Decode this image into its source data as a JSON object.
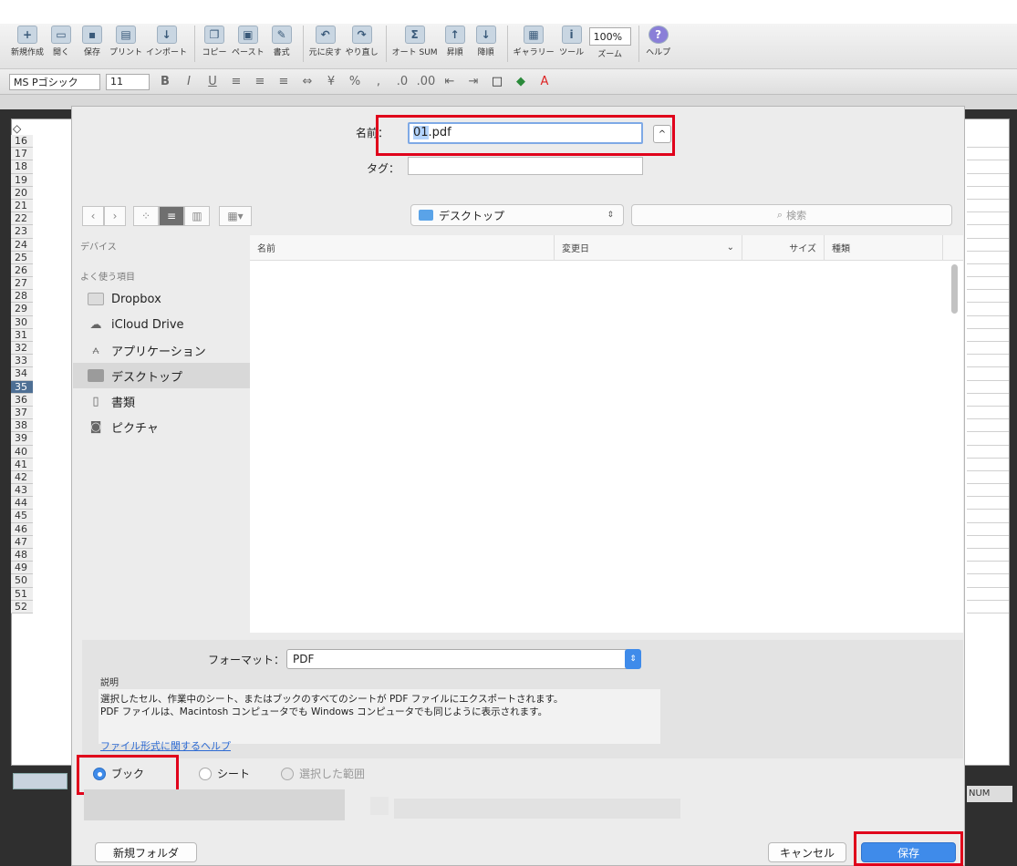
{
  "ribbon": {
    "buttons": [
      "新規作成",
      "開く",
      "保存",
      "プリント",
      "インポート",
      "コピー",
      "ペースト",
      "書式",
      "元に戻す",
      "やり直し",
      "オート SUM",
      "昇順",
      "降順",
      "ギャラリー",
      "ツール",
      "ズーム",
      "ヘルプ"
    ],
    "zoom": "100%"
  },
  "formatbar": {
    "font": "MS Pゴシック",
    "size": "11"
  },
  "sheet": {
    "rows": [
      "16",
      "17",
      "18",
      "19",
      "20",
      "21",
      "22",
      "23",
      "24",
      "25",
      "26",
      "27",
      "28",
      "29",
      "30",
      "31",
      "32",
      "33",
      "34",
      "35",
      "36",
      "37",
      "38",
      "39",
      "40",
      "41",
      "42",
      "43",
      "44",
      "45",
      "46",
      "47",
      "48",
      "49",
      "50",
      "51",
      "52"
    ],
    "selected_row": "35",
    "status": "NUM"
  },
  "dialog": {
    "name_label": "名前：",
    "filename_highlight": "01",
    "filename_rest": ".pdf",
    "tag_label": "タグ：",
    "location": "デスクトップ",
    "search_placeholder": "検索",
    "sidebar": {
      "devices": "デバイス",
      "favorites": "よく使う項目",
      "items": [
        "Dropbox",
        "iCloud Drive",
        "アプリケーション",
        "デスクトップ",
        "書類",
        "ピクチャ"
      ]
    },
    "columns": {
      "name": "名前",
      "modified": "変更日",
      "size": "サイズ",
      "kind": "種類"
    },
    "format_label": "フォーマット：",
    "format_value": "PDF",
    "description_label": "説明",
    "description_lines": [
      "選択したセル、作業中のシート、またはブックのすべてのシートが PDF ファイルにエクスポートされます。",
      "PDF ファイルは、Macintosh コンピュータでも Windows コンピュータでも同じように表示されます。"
    ],
    "help_link": "ファイル形式に関するヘルプ",
    "scope": {
      "book": "ブック",
      "sheet": "シート",
      "selection": "選択した範囲"
    },
    "new_folder": "新規フォルダ",
    "cancel": "キャンセル",
    "save": "保存",
    "accent_color": "#3f8bea",
    "highlight_color": "#e0001b"
  }
}
